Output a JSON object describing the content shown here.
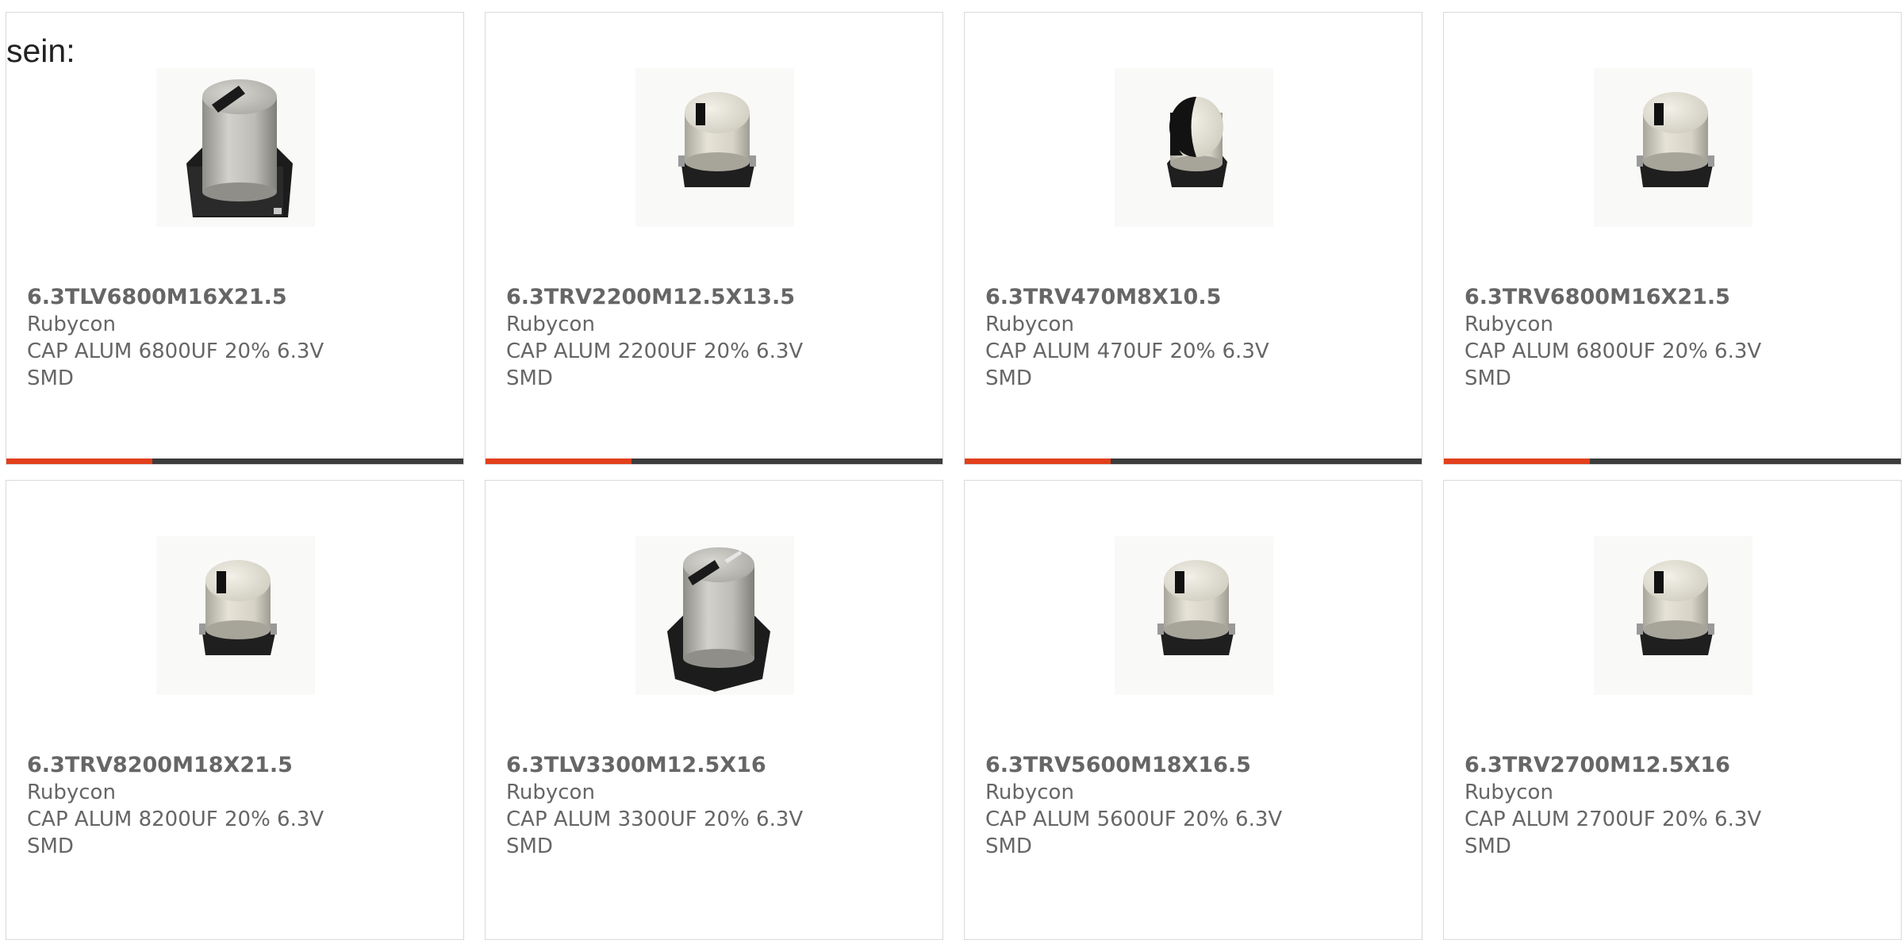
{
  "intro_text": "sein:",
  "colors": {
    "accent": "#e2401c",
    "bar_track": "#3c3c3c",
    "text": "#666666",
    "border": "#d9d9d9"
  },
  "products": [
    {
      "part_number": "6.3TLV6800M16X21.5",
      "manufacturer": "Rubycon",
      "description": "CAP ALUM 6800UF 20% 6.3V SMD",
      "image": "capacitor-large-tilted",
      "progress": 0.32
    },
    {
      "part_number": "6.3TRV2200M12.5X13.5",
      "manufacturer": "Rubycon",
      "description": "CAP ALUM 2200UF 20% 6.3V SMD",
      "image": "capacitor-small",
      "progress": 0.32
    },
    {
      "part_number": "6.3TRV470M8X10.5",
      "manufacturer": "Rubycon",
      "description": "CAP ALUM 470UF 20% 6.3V SMD",
      "image": "capacitor-halfblack",
      "progress": 0.32
    },
    {
      "part_number": "6.3TRV6800M16X21.5",
      "manufacturer": "Rubycon",
      "description": "CAP ALUM 6800UF 20% 6.3V SMD",
      "image": "capacitor-small",
      "progress": 0.32
    },
    {
      "part_number": "6.3TRV8200M18X21.5",
      "manufacturer": "Rubycon",
      "description": "CAP ALUM 8200UF 20% 6.3V SMD",
      "image": "capacitor-small"
    },
    {
      "part_number": "6.3TLV3300M12.5X16",
      "manufacturer": "Rubycon",
      "description": "CAP ALUM 3300UF 20% 6.3V SMD",
      "image": "capacitor-large-tilted"
    },
    {
      "part_number": "6.3TRV5600M18X16.5",
      "manufacturer": "Rubycon",
      "description": "CAP ALUM 5600UF 20% 6.3V SMD",
      "image": "capacitor-small"
    },
    {
      "part_number": "6.3TRV2700M12.5X16",
      "manufacturer": "Rubycon",
      "description": "CAP ALUM 2700UF 20% 6.3V SMD",
      "image": "capacitor-small"
    }
  ]
}
